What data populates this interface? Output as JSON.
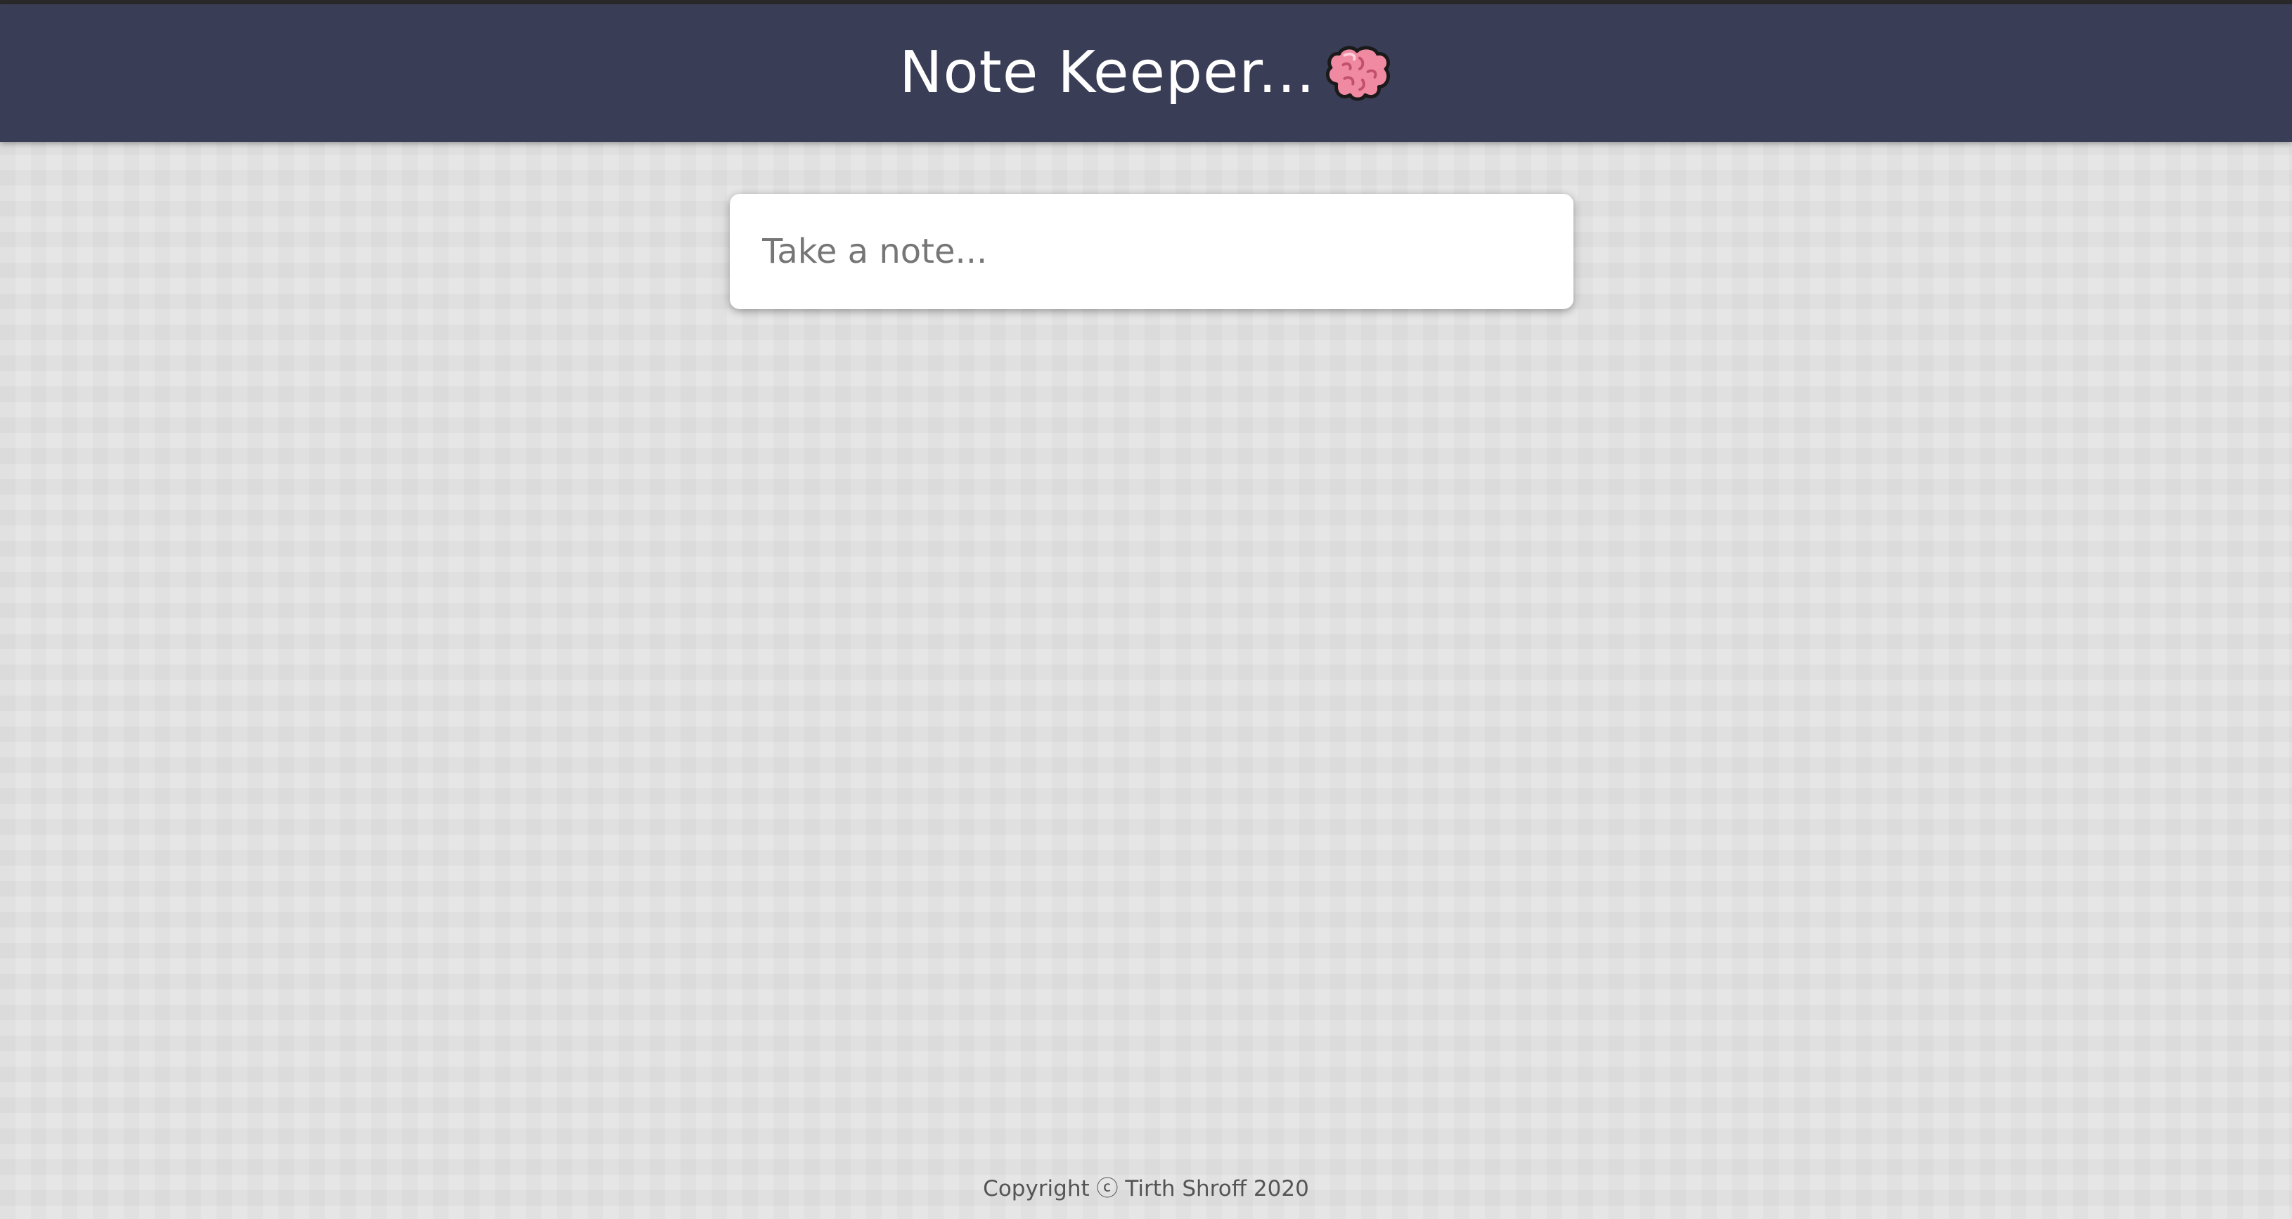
{
  "header": {
    "title": "Note Keeper...",
    "icon": "brain-icon"
  },
  "note_input": {
    "placeholder": "Take a note...",
    "value": ""
  },
  "footer": {
    "copyright": "Copyright ⓒ Tirth Shroff 2020"
  },
  "colors": {
    "header_bg": "#393d56",
    "page_bg": "#e0e0e0",
    "brain_pink": "#f08aa2"
  }
}
